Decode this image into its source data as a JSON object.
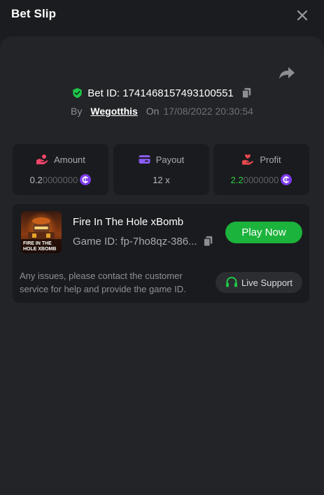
{
  "header": {
    "title": "Bet Slip"
  },
  "bet": {
    "id_text": "Bet ID: 1741468157493100551",
    "by_label": "By",
    "username": "Wegotthis",
    "on_label": "On",
    "date": "17/08/2022 20:30:54"
  },
  "stats": {
    "amount": {
      "label": "Amount",
      "value_lead": "0.2",
      "value_tail": "0000000"
    },
    "payout": {
      "label": "Payout",
      "value": "12 x"
    },
    "profit": {
      "label": "Profit",
      "value_lead": "2.2",
      "value_tail": "0000000"
    }
  },
  "game": {
    "name": "Fire In The Hole xBomb",
    "id_text": "Game ID: fp-7ho8qz-386...",
    "play_label": "Play Now",
    "thumb_line1": "FIRE IN THE",
    "thumb_line2": "HOLE XBOMB",
    "issues_text": "Any issues, please contact the customer service for help and provide the game ID.",
    "support_label": "Live Support"
  },
  "icons": {
    "close": "close-icon",
    "share": "share-icon",
    "shield": "shield-check-icon",
    "copy": "copy-icon",
    "amount": "hand-coins-icon",
    "payout": "wallet-card-icon",
    "profit": "hand-heart-icon",
    "coin": "coin-icon",
    "headset": "headset-icon"
  },
  "colors": {
    "background": "#1b1c1f",
    "panel": "#232427",
    "card": "#1a1b1e",
    "accent_green": "#1cb33c",
    "profit_green": "#2ecc48",
    "coin_purple": "#7c3aed",
    "amount_pink": "#f0456a",
    "payout_purple": "#8b5cf6",
    "profit_red": "#e5484d"
  }
}
